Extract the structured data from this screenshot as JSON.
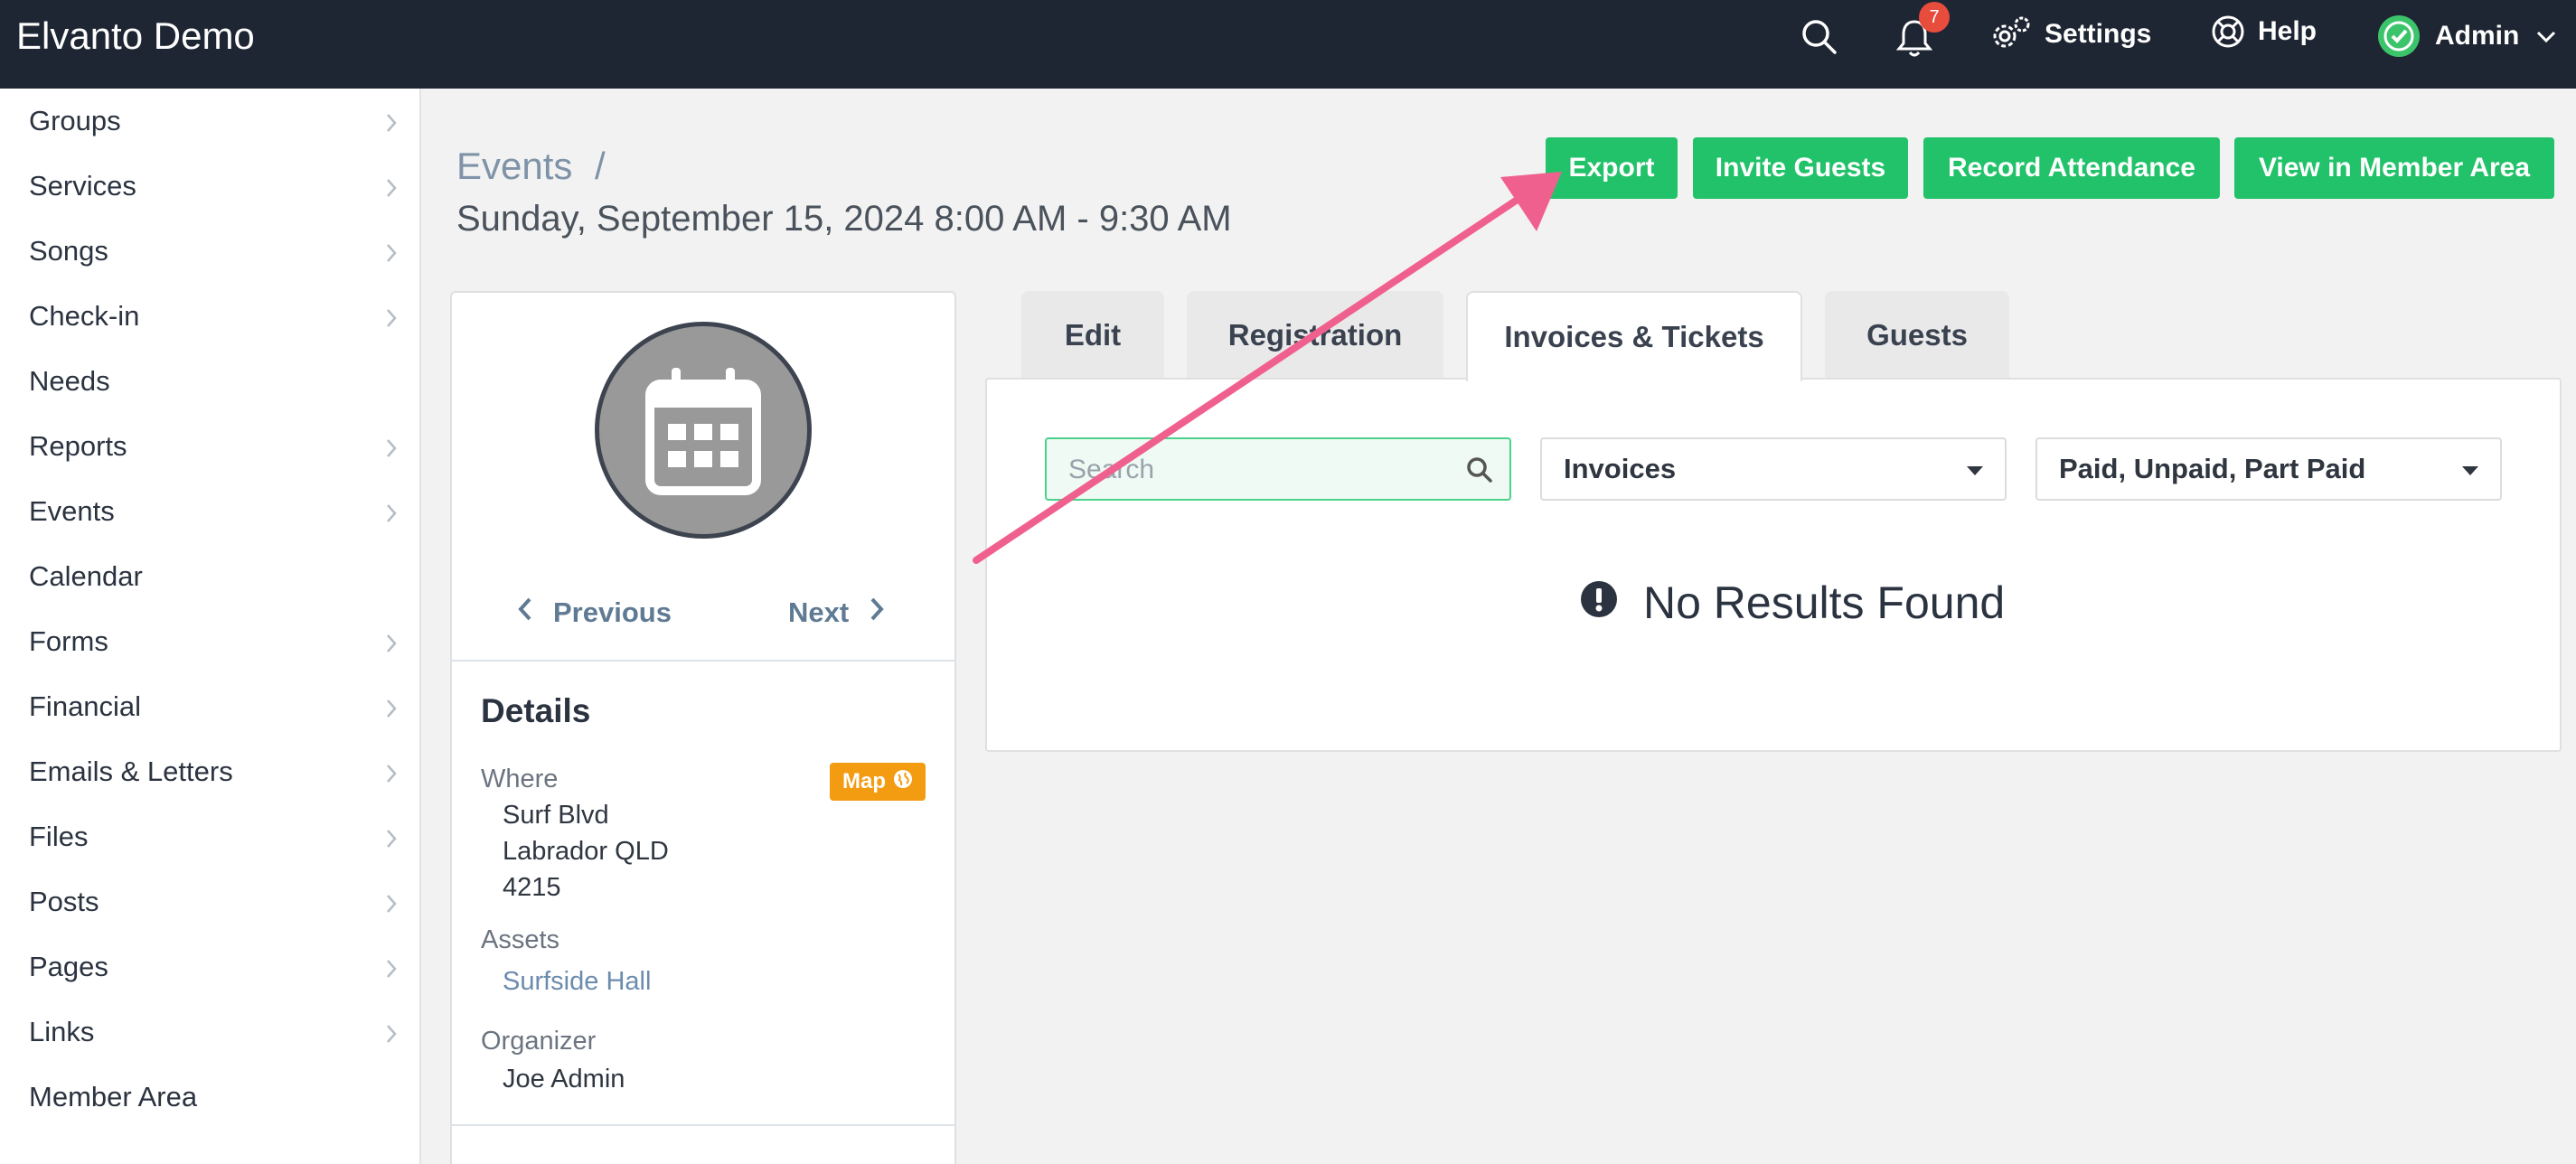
{
  "app": {
    "title": "Elvanto Demo"
  },
  "topbar": {
    "notification_count": "7",
    "settings_label": "Settings",
    "help_label": "Help",
    "admin_label": "Admin"
  },
  "sidebar": {
    "items": [
      {
        "label": "Groups",
        "has_chevron": true
      },
      {
        "label": "Services",
        "has_chevron": true
      },
      {
        "label": "Songs",
        "has_chevron": true
      },
      {
        "label": "Check-in",
        "has_chevron": true
      },
      {
        "label": "Needs",
        "has_chevron": false
      },
      {
        "label": "Reports",
        "has_chevron": true
      },
      {
        "label": "Events",
        "has_chevron": true
      },
      {
        "label": "Calendar",
        "has_chevron": false
      },
      {
        "label": "Forms",
        "has_chevron": true
      },
      {
        "label": "Financial",
        "has_chevron": true
      },
      {
        "label": "Emails & Letters",
        "has_chevron": true
      },
      {
        "label": "Files",
        "has_chevron": true
      },
      {
        "label": "Posts",
        "has_chevron": true
      },
      {
        "label": "Pages",
        "has_chevron": true
      },
      {
        "label": "Links",
        "has_chevron": true
      },
      {
        "label": "Member Area",
        "has_chevron": false
      }
    ]
  },
  "breadcrumb": {
    "parent": "Events",
    "separator": "/"
  },
  "page": {
    "title": "Sunday, September 15, 2024 8:00 AM - 9:30 AM"
  },
  "actions": {
    "export": "Export",
    "invite_guests": "Invite Guests",
    "record_attendance": "Record Attendance",
    "view_member_area": "View in Member Area"
  },
  "event_panel": {
    "previous": "Previous",
    "next": "Next",
    "details_heading": "Details",
    "where_label": "Where",
    "map_label": "Map",
    "address_line1": "Surf Blvd",
    "address_line2": "Labrador QLD",
    "address_line3": "4215",
    "assets_label": "Assets",
    "asset_value": "Surfside Hall",
    "organizer_label": "Organizer",
    "organizer_value": "Joe Admin"
  },
  "tabs": [
    {
      "label": "Edit",
      "active": false
    },
    {
      "label": "Registration",
      "active": false
    },
    {
      "label": "Invoices & Tickets",
      "active": true
    },
    {
      "label": "Guests",
      "active": false
    }
  ],
  "filters": {
    "search_placeholder": "Search",
    "type_selected": "Invoices",
    "status_selected": "Paid, Unpaid, Part Paid"
  },
  "results": {
    "empty_message": "No Results Found"
  },
  "colors": {
    "topbar_bg": "#1f2633",
    "accent_green": "#21c26a",
    "map_orange": "#f39c12",
    "badge_red": "#e74c3c",
    "annotation_pink": "#f0608e"
  }
}
